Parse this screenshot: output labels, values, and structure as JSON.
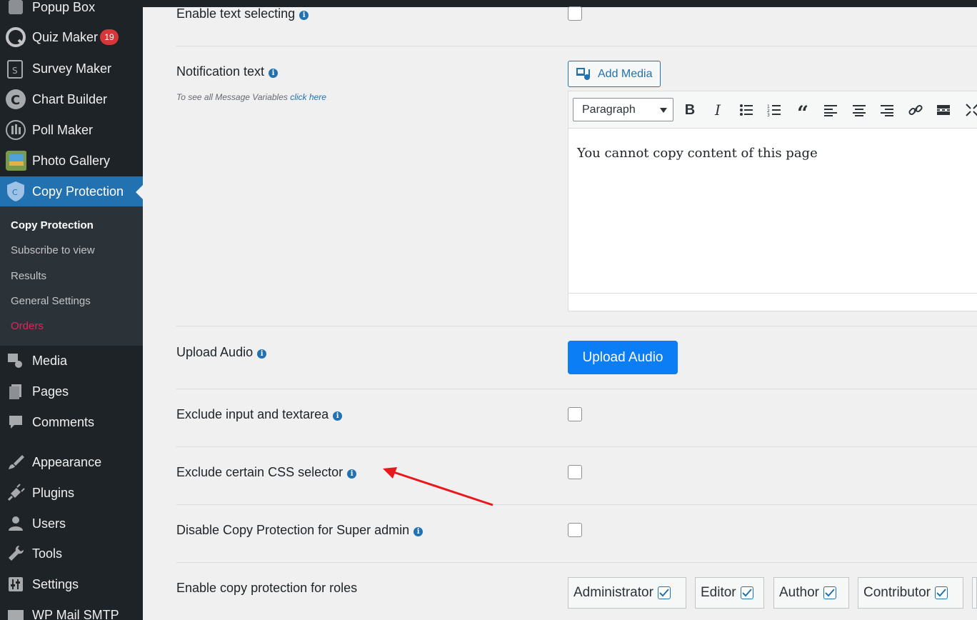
{
  "sidebar": {
    "top_items": [
      {
        "label": "Popup Box",
        "icon": "popup-icon"
      },
      {
        "label": "Quiz Maker",
        "icon": "quiz-icon",
        "badge": "19"
      },
      {
        "label": "Survey Maker",
        "icon": "survey-icon"
      },
      {
        "label": "Chart Builder",
        "icon": "chart-icon"
      },
      {
        "label": "Poll Maker",
        "icon": "poll-icon"
      },
      {
        "label": "Photo Gallery",
        "icon": "gallery-icon"
      },
      {
        "label": "Copy Protection",
        "icon": "shield-icon",
        "active": true
      }
    ],
    "submenu": [
      {
        "label": "Copy Protection",
        "current": true
      },
      {
        "label": "Subscribe to view"
      },
      {
        "label": "Results"
      },
      {
        "label": "General Settings"
      },
      {
        "label": "Orders"
      }
    ],
    "bottom_items": [
      {
        "label": "Media",
        "icon": "media-icon"
      },
      {
        "label": "Pages",
        "icon": "pages-icon"
      },
      {
        "label": "Comments",
        "icon": "comments-icon"
      },
      {
        "label": "Appearance",
        "icon": "brush-icon"
      },
      {
        "label": "Plugins",
        "icon": "plug-icon"
      },
      {
        "label": "Users",
        "icon": "user-icon"
      },
      {
        "label": "Tools",
        "icon": "wrench-icon"
      },
      {
        "label": "Settings",
        "icon": "settings-icon"
      },
      {
        "label": "WP Mail SMTP",
        "icon": "mail-icon"
      }
    ]
  },
  "settings": {
    "enable_text_selecting": {
      "label": "Enable text selecting",
      "checked": false
    },
    "notification_text": {
      "label": "Notification text",
      "hint_prefix": "To see all Message Variables",
      "hint_link": "click here",
      "add_media_label": "Add Media",
      "format_value": "Paragraph",
      "content": "You cannot copy content of this page"
    },
    "upload_audio": {
      "label": "Upload Audio",
      "button_label": "Upload Audio"
    },
    "exclude_input": {
      "label": "Exclude input and textarea",
      "checked": false
    },
    "exclude_css": {
      "label": "Exclude certain CSS selector",
      "checked": false
    },
    "disable_super_admin": {
      "label": "Disable Copy Protection for Super admin",
      "checked": false
    },
    "roles": {
      "label": "Enable copy protection for roles",
      "items": [
        {
          "label": "Administrator",
          "checked": true
        },
        {
          "label": "Editor",
          "checked": true
        },
        {
          "label": "Author",
          "checked": true
        },
        {
          "label": "Contributor",
          "checked": true
        }
      ]
    }
  },
  "colors": {
    "accent": "#2271b1",
    "upload_button": "#0b7ef6",
    "arrow": "#e8191c",
    "orders_link": "#e0245e"
  }
}
